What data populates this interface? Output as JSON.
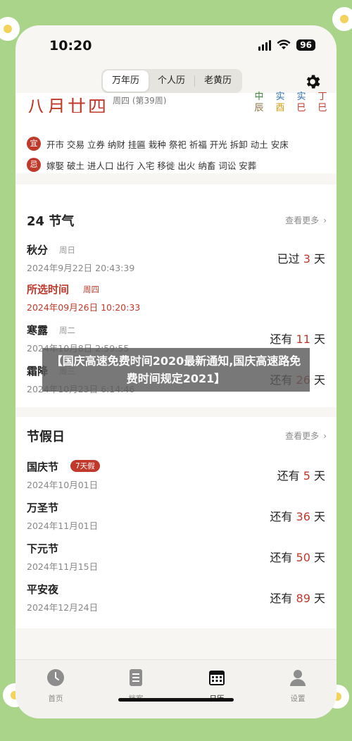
{
  "status": {
    "time": "10:20",
    "battery": "96"
  },
  "segments": [
    "万年历",
    "个人历",
    "老黄历"
  ],
  "lunar": {
    "title": "八月廿四",
    "week": "周四 (第39周)",
    "ganzhi_top": [
      "中",
      "实",
      "实",
      "丁"
    ],
    "ganzhi_bottom": [
      "辰",
      "酉",
      "巳",
      "巳"
    ],
    "yi_label": "宜",
    "yi": "开市 交易 立券 纳财 挂匾 栽种 祭祀 祈福 开光 拆卸 动土 安床",
    "ji_label": "忌",
    "ji": "嫁娶 破土 进人口 出行 入宅 移徙 出火 纳畜 词讼 安葬"
  },
  "solar_terms": {
    "title": "24 节气",
    "see_more": "查看更多",
    "items": [
      {
        "name": "秋分",
        "week": "周日",
        "date": "2024年9月22日 20:43:39",
        "prefix": "已过",
        "num": "3",
        "suffix": "天"
      },
      {
        "name": "所选时间",
        "week": "周四",
        "date": "2024年09月26日 10:20:33",
        "prefix": "",
        "num": "",
        "suffix": ""
      },
      {
        "name": "寒露",
        "week": "周二",
        "date": "2024年10月8日 2:59:55",
        "prefix": "还有",
        "num": "11",
        "suffix": "天"
      },
      {
        "name": "霜降",
        "week": "周三",
        "date": "2024年10月23日 6:14:46",
        "prefix": "还有",
        "num": "26",
        "suffix": "天"
      }
    ]
  },
  "holidays": {
    "title": "节假日",
    "see_more": "查看更多",
    "items": [
      {
        "name": "国庆节",
        "badge": "7天假",
        "date": "2024年10月01日",
        "prefix": "还有",
        "num": "5",
        "suffix": "天"
      },
      {
        "name": "万圣节",
        "badge": "",
        "date": "2024年11月01日",
        "prefix": "还有",
        "num": "36",
        "suffix": "天"
      },
      {
        "name": "下元节",
        "badge": "",
        "date": "2024年11月15日",
        "prefix": "还有",
        "num": "50",
        "suffix": "天"
      },
      {
        "name": "平安夜",
        "badge": "",
        "date": "2024年12月24日",
        "prefix": "还有",
        "num": "89",
        "suffix": "天"
      }
    ]
  },
  "banner": "【国庆高速免费时间2020最新通知,国庆高速路免费时间规定2021】",
  "tabbar": [
    "首页",
    "档案",
    "日历",
    "设置"
  ],
  "colors": {
    "accent_red": "#c0392b",
    "background_green": "#a9d48a"
  }
}
